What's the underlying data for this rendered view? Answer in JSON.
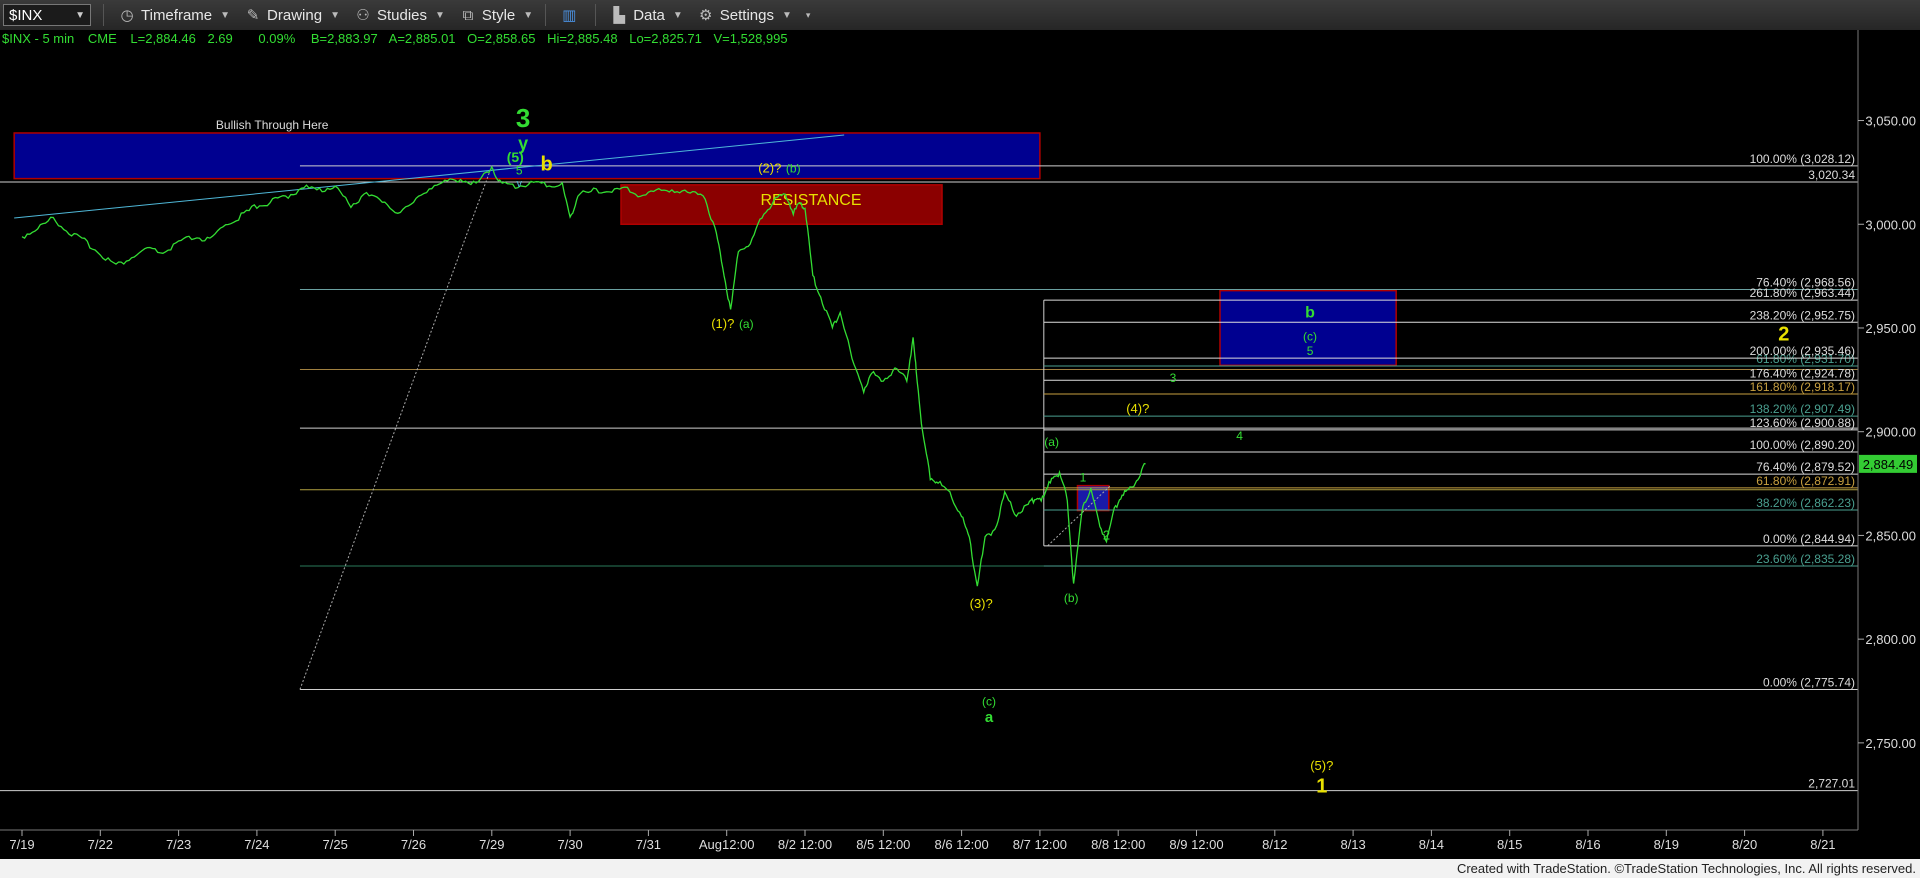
{
  "toolbar": {
    "symbol": "$INX",
    "items": [
      {
        "label": "Timeframe",
        "icon": "clock-icon"
      },
      {
        "label": "Drawing",
        "icon": "pen-icon"
      },
      {
        "label": "Studies",
        "icon": "studies-icon"
      },
      {
        "label": "Style",
        "icon": "style-icon"
      },
      {
        "label": "Data",
        "icon": "data-icon"
      },
      {
        "label": "Settings",
        "icon": "gear-icon"
      }
    ]
  },
  "header": {
    "symbol": "$INX - 5 min",
    "exchange": "CME",
    "last": "L=2,884.46",
    "change": "2.69",
    "pct": "0.09%",
    "bid": "B=2,883.97",
    "ask": "A=2,885.01",
    "open": "O=2,858.65",
    "high": "Hi=2,885.48",
    "low": "Lo=2,825.71",
    "volume": "V=1,528,995"
  },
  "footer": "Created with TradeStation. ©TradeStation Technologies, Inc. All rights reserved.",
  "colors": {
    "price": "#33dd33",
    "wave_green": "#33dd33",
    "wave_yellow": "#e8e000",
    "fib_white": "#cfcfcf",
    "zone_blue": "#000090",
    "zone_red": "#8b0000",
    "last_marker": "#33cc33"
  },
  "chart_data": {
    "type": "line",
    "title": "$INX - 5 min",
    "ylim": [
      2708,
      3084
    ],
    "y_ticks": [
      "3,050.00",
      "3,000.00",
      "2,950.00",
      "2,900.00",
      "2,850.00",
      "2,800.00",
      "2,750.00"
    ],
    "y_tick_values": [
      3050,
      3000,
      2950,
      2900,
      2850,
      2800,
      2750
    ],
    "x_ticks": [
      "7/19",
      "7/22",
      "7/23",
      "7/24",
      "7/25",
      "7/26",
      "7/29",
      "7/30",
      "7/31",
      "Aug12:00",
      "8/2 12:00",
      "8/5 12:00",
      "8/6 12:00",
      "8/7 12:00",
      "8/8 12:00",
      "8/9 12:00",
      "8/12",
      "8/13",
      "8/14",
      "8/15",
      "8/16",
      "8/19",
      "8/20",
      "8/21"
    ],
    "x_tick_index": [
      0,
      1,
      2,
      3,
      4,
      5,
      6,
      7,
      8,
      9,
      10,
      11,
      12,
      13,
      14,
      15,
      16,
      17,
      18,
      19,
      20,
      21,
      22,
      23
    ],
    "last_price": "2,884.49",
    "last_value": 2884.49,
    "series": [
      {
        "points": [
          [
            0,
            2994
          ],
          [
            0.2,
            2998
          ],
          [
            0.4,
            3003
          ],
          [
            0.6,
            2996
          ],
          [
            0.8,
            2992
          ],
          [
            1.0,
            2986
          ],
          [
            1.2,
            2980
          ],
          [
            1.4,
            2984
          ],
          [
            1.6,
            2988
          ],
          [
            1.8,
            2986
          ],
          [
            2.0,
            2991
          ],
          [
            2.2,
            2994
          ],
          [
            2.4,
            2992
          ],
          [
            2.6,
            3000
          ],
          [
            2.8,
            3004
          ],
          [
            3.0,
            3009
          ],
          [
            3.2,
            3011
          ],
          [
            3.4,
            3014
          ],
          [
            3.6,
            3018
          ],
          [
            3.8,
            3016
          ],
          [
            4.0,
            3019
          ],
          [
            4.2,
            3008
          ],
          [
            4.4,
            3016
          ],
          [
            4.6,
            3010
          ],
          [
            4.8,
            3006
          ],
          [
            5.0,
            3010
          ],
          [
            5.2,
            3018
          ],
          [
            5.4,
            3020
          ],
          [
            5.6,
            3022
          ],
          [
            5.8,
            3019
          ],
          [
            6.0,
            3028
          ],
          [
            6.1,
            3020
          ],
          [
            6.3,
            3018
          ],
          [
            6.5,
            3020
          ],
          [
            6.7,
            3019
          ],
          [
            6.9,
            3019
          ],
          [
            7.0,
            3003
          ],
          [
            7.1,
            3014
          ],
          [
            7.3,
            3016
          ],
          [
            7.5,
            3016
          ],
          [
            7.7,
            3017
          ],
          [
            7.9,
            3014
          ],
          [
            8.1,
            3016
          ],
          [
            8.3,
            3017
          ],
          [
            8.5,
            3015
          ],
          [
            8.7,
            3015
          ],
          [
            8.85,
            2998
          ],
          [
            8.95,
            2980
          ],
          [
            9.05,
            2958
          ],
          [
            9.15,
            2988
          ],
          [
            9.3,
            2990
          ],
          [
            9.45,
            3004
          ],
          [
            9.6,
            3011
          ],
          [
            9.75,
            3015
          ],
          [
            9.85,
            3006
          ],
          [
            9.95,
            3010
          ],
          [
            10.0,
            3008
          ],
          [
            10.1,
            2975
          ],
          [
            10.2,
            2965
          ],
          [
            10.35,
            2950
          ],
          [
            10.45,
            2958
          ],
          [
            10.6,
            2935
          ],
          [
            10.75,
            2920
          ],
          [
            10.85,
            2928
          ],
          [
            11.0,
            2925
          ],
          [
            11.15,
            2930
          ],
          [
            11.3,
            2925
          ],
          [
            11.38,
            2945
          ],
          [
            11.42,
            2930
          ],
          [
            11.5,
            2900
          ],
          [
            11.6,
            2878
          ],
          [
            11.7,
            2876
          ],
          [
            11.85,
            2870
          ],
          [
            12.0,
            2860
          ],
          [
            12.1,
            2848
          ],
          [
            12.2,
            2826
          ],
          [
            12.3,
            2848
          ],
          [
            12.45,
            2855
          ],
          [
            12.55,
            2870
          ],
          [
            12.7,
            2860
          ],
          [
            12.85,
            2865
          ],
          [
            12.95,
            2868
          ],
          [
            13.05,
            2868
          ],
          [
            13.15,
            2878
          ],
          [
            13.25,
            2880
          ],
          [
            13.35,
            2868
          ],
          [
            13.43,
            2826
          ],
          [
            13.55,
            2865
          ],
          [
            13.65,
            2872
          ],
          [
            13.75,
            2856
          ],
          [
            13.85,
            2848
          ],
          [
            13.95,
            2862
          ],
          [
            14.05,
            2870
          ],
          [
            14.15,
            2872
          ],
          [
            14.25,
            2878
          ],
          [
            14.35,
            2884.5
          ]
        ]
      }
    ],
    "horizontal_lines": [
      {
        "value": 3028.12,
        "label": "100.00% (3,028.12)",
        "color": "#cfcfcf"
      },
      {
        "value": 3020.34,
        "label": "3,020.34",
        "color": "#cfcfcf"
      },
      {
        "value": 2968.56,
        "label": "76.40% (2,968.56)",
        "color": "#6aa0a0"
      },
      {
        "value": 2901.7,
        "label": "",
        "color": "#cfcfcf"
      },
      {
        "value": 2930.0,
        "label": "",
        "color": "#a08040"
      },
      {
        "value": 2872.0,
        "label": "",
        "color": "#b0a040"
      },
      {
        "value": 2835.28,
        "label": "",
        "color": "#2a7a5a"
      },
      {
        "value": 2775.74,
        "label": "0.00% (2,775.74)",
        "color": "#cfcfcf"
      },
      {
        "value": 2727.01,
        "label": "2,727.01",
        "color": "#cfcfcf"
      }
    ],
    "fib_levels": [
      {
        "value": 2963.44,
        "label": "261.80% (2,963.44)",
        "color": "#dddddd"
      },
      {
        "value": 2952.75,
        "label": "238.20% (2,952.75)",
        "color": "#dddddd"
      },
      {
        "value": 2931.7,
        "label": "61.80% (2,931.70)",
        "color": "#4aa090"
      },
      {
        "value": 2935.46,
        "label": "200.00% (2,935.46)",
        "color": "#dddddd"
      },
      {
        "value": 2924.78,
        "label": "176.40% (2,924.78)",
        "color": "#dddddd"
      },
      {
        "value": 2918.17,
        "label": "161.80% (2,918.17)",
        "color": "#c8a040"
      },
      {
        "value": 2907.49,
        "label": "138.20% (2,907.49)",
        "color": "#4aa090"
      },
      {
        "value": 2900.88,
        "label": "123.60% (2,900.88)",
        "color": "#dddddd"
      },
      {
        "value": 2890.2,
        "label": "100.00% (2,890.20)",
        "color": "#dddddd"
      },
      {
        "value": 2879.52,
        "label": "76.40% (2,879.52)",
        "color": "#dddddd"
      },
      {
        "value": 2872.91,
        "label": "61.80% (2,872.91)",
        "color": "#c8a040"
      },
      {
        "value": 2862.23,
        "label": "38.20% (2,862.23)",
        "color": "#4aa090"
      },
      {
        "value": 2844.94,
        "label": "0.00% (2,844.94)",
        "color": "#dddddd"
      },
      {
        "value": 2835.28,
        "label": "23.60% (2,835.28)",
        "color": "#4aa090"
      }
    ],
    "zones": [
      {
        "x0": -0.1,
        "x1": 13.0,
        "y0": 3022,
        "y1": 3044,
        "color": "#000090",
        "border": "#b00000",
        "label": "Bullish Through Here"
      },
      {
        "x0": 7.65,
        "x1": 11.75,
        "y0": 3000,
        "y1": 3019,
        "color": "#8b0000",
        "border": "#b00000",
        "label": "RESISTANCE"
      },
      {
        "x0": 15.3,
        "x1": 17.55,
        "y0": 2932,
        "y1": 2968,
        "color": "#000090",
        "border": "#b00000",
        "label": ""
      },
      {
        "x0": 13.48,
        "x1": 13.88,
        "y0": 2862,
        "y1": 2874,
        "color": "#1a1aa8",
        "border": "#b00000",
        "label": ""
      }
    ],
    "trend_lines": [
      {
        "x0": -0.1,
        "y0": 3003,
        "x1": 10.5,
        "y1": 3043,
        "color": "#4fb8d8",
        "dash": false
      },
      {
        "x0": 3.55,
        "y0": 2775.74,
        "x1": 6.0,
        "y1": 3028.12,
        "color": "#aaaaaa",
        "dash": true
      },
      {
        "x0": 13.1,
        "y0": 2845,
        "x1": 13.9,
        "y1": 2874,
        "color": "#aaaaaa",
        "dash": true
      }
    ],
    "wave_labels": [
      {
        "text": "3",
        "x": 6.4,
        "y": 3047,
        "color": "#33dd33",
        "size": 26,
        "bold": true
      },
      {
        "text": "y",
        "x": 6.4,
        "y": 3036,
        "color": "#33dd33",
        "size": 18,
        "bold": true
      },
      {
        "text": "(5)",
        "x": 6.3,
        "y": 3030,
        "color": "#33dd33",
        "size": 14,
        "bold": true
      },
      {
        "text": "5",
        "x": 6.35,
        "y": 3024,
        "color": "#33dd33",
        "size": 12,
        "bold": false
      },
      {
        "text": "v",
        "x": 6.35,
        "y": 3018,
        "color": "#4fb8d8",
        "size": 11,
        "bold": false
      },
      {
        "text": "b",
        "x": 6.7,
        "y": 3026,
        "color": "#e8e000",
        "size": 20,
        "bold": true
      },
      {
        "text": "(2)?",
        "x": 9.55,
        "y": 3025,
        "color": "#e8e000",
        "size": 13,
        "bold": false
      },
      {
        "text": "(b)",
        "x": 9.85,
        "y": 3025,
        "color": "#33dd33",
        "size": 12,
        "bold": false
      },
      {
        "text": "(1)?",
        "x": 8.95,
        "y": 2950,
        "color": "#e8e000",
        "size": 13,
        "bold": false
      },
      {
        "text": "(a)",
        "x": 9.25,
        "y": 2950,
        "color": "#33dd33",
        "size": 12,
        "bold": false
      },
      {
        "text": "(3)?",
        "x": 12.25,
        "y": 2815,
        "color": "#e8e000",
        "size": 13,
        "bold": false
      },
      {
        "text": "(c)",
        "x": 12.35,
        "y": 2768,
        "color": "#33dd33",
        "size": 12,
        "bold": false
      },
      {
        "text": "a",
        "x": 12.35,
        "y": 2760,
        "color": "#33dd33",
        "size": 15,
        "bold": true
      },
      {
        "text": "(a)",
        "x": 13.15,
        "y": 2893,
        "color": "#33dd33",
        "size": 12,
        "bold": false
      },
      {
        "text": "1",
        "x": 13.55,
        "y": 2876,
        "color": "#33dd33",
        "size": 12,
        "bold": false
      },
      {
        "text": "(b)",
        "x": 13.4,
        "y": 2818,
        "color": "#33dd33",
        "size": 12,
        "bold": false
      },
      {
        "text": "2",
        "x": 13.85,
        "y": 2848,
        "color": "#33dd33",
        "size": 13,
        "bold": false
      },
      {
        "text": "3",
        "x": 14.7,
        "y": 2924,
        "color": "#33dd33",
        "size": 12,
        "bold": false
      },
      {
        "text": "4",
        "x": 15.55,
        "y": 2896,
        "color": "#33dd33",
        "size": 12,
        "bold": false
      },
      {
        "text": "(4)?",
        "x": 14.25,
        "y": 2909,
        "color": "#e8e000",
        "size": 13,
        "bold": false
      },
      {
        "text": "b",
        "x": 16.45,
        "y": 2955,
        "color": "#33dd33",
        "size": 16,
        "bold": true
      },
      {
        "text": "(c)",
        "x": 16.45,
        "y": 2944,
        "color": "#33dd33",
        "size": 12,
        "bold": false
      },
      {
        "text": "5",
        "x": 16.45,
        "y": 2937,
        "color": "#33dd33",
        "size": 12,
        "bold": false
      },
      {
        "text": "2",
        "x": 22.5,
        "y": 2944,
        "color": "#e8e000",
        "size": 20,
        "bold": true
      },
      {
        "text": "(5)?",
        "x": 16.6,
        "y": 2737,
        "color": "#e8e000",
        "size": 13,
        "bold": false
      },
      {
        "text": "1",
        "x": 16.6,
        "y": 2726,
        "color": "#e8e000",
        "size": 20,
        "bold": true
      }
    ]
  }
}
